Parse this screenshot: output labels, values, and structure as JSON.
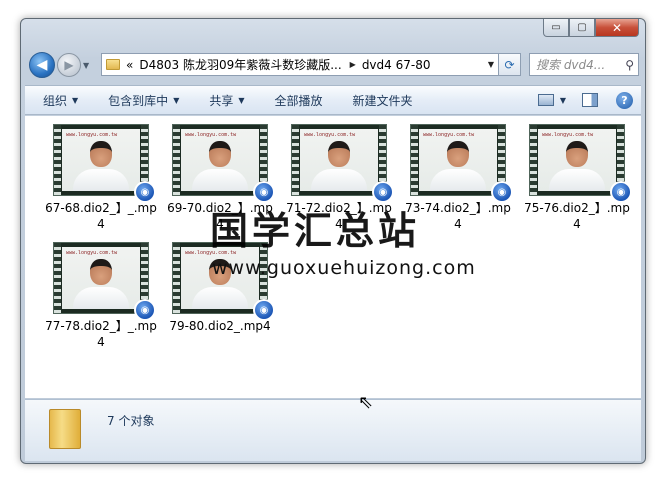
{
  "window": {
    "caption": {
      "min": "▭",
      "max": "▢",
      "close": "✕"
    }
  },
  "nav": {
    "back": "◀",
    "forward": "▶"
  },
  "address": {
    "prefix": "«",
    "segments": [
      "D4803 陈龙羽09年紫薇斗数珍藏版...",
      "dvd4    67-80"
    ],
    "separator": "▶"
  },
  "search": {
    "placeholder": "搜索 dvd4..."
  },
  "toolbar": {
    "organize": "组织",
    "include_in_library": "包含到库中",
    "share": "共享",
    "play_all": "全部播放",
    "new_folder": "新建文件夹"
  },
  "files": [
    {
      "name": "67-68.dio2_】_.mp4"
    },
    {
      "name": "69-70.dio2_】.mp4"
    },
    {
      "name": "71-72.dio2_】.mp4"
    },
    {
      "name": "73-74.dio2_】.mp4"
    },
    {
      "name": "75-76.dio2_】.mp4"
    },
    {
      "name": "77-78.dio2_】_.mp4"
    },
    {
      "name": "79-80.dio2_.mp4"
    }
  ],
  "thumb_caption": "www.longyu.com.tw",
  "watermark": {
    "line1": "国学汇总站",
    "line2": "www.guoxuehuizong.com"
  },
  "status": {
    "count": "7 个对象"
  },
  "icons": {
    "back": "back-arrow-icon",
    "forward": "forward-arrow-icon",
    "search": "search-icon",
    "refresh": "refresh-icon",
    "help": "help-icon",
    "folder": "folder-icon",
    "media": "media-player-badge-icon"
  }
}
